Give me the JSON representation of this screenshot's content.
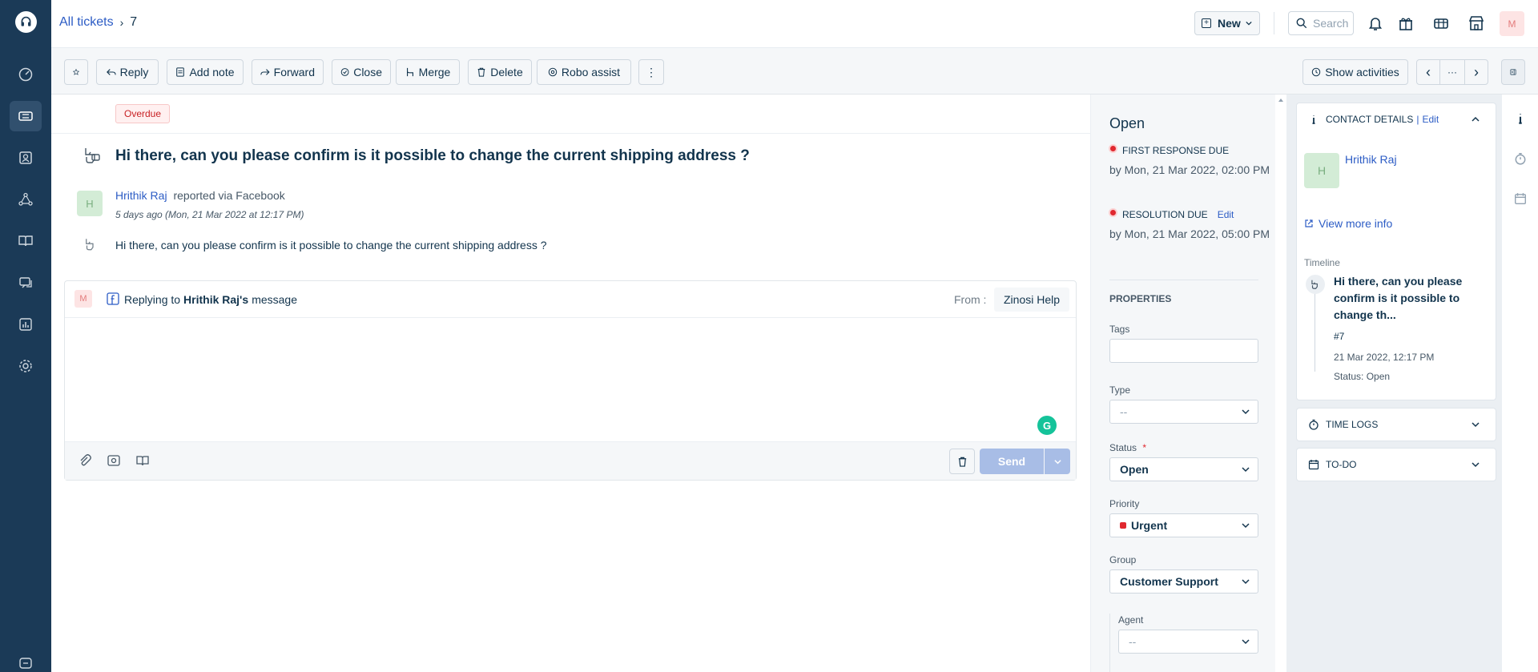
{
  "breadcrumb": {
    "link": "All tickets",
    "separator": "›",
    "ticket_number": "7"
  },
  "topbar": {
    "new_label": "New",
    "search_placeholder": "Search",
    "user_initial": "M"
  },
  "toolbar": {
    "reply": "Reply",
    "add_note": "Add note",
    "forward": "Forward",
    "close": "Close",
    "merge": "Merge",
    "delete": "Delete",
    "robo_assist": "Robo assist",
    "more": "⋮",
    "show_activities": "Show activities",
    "prev": "‹",
    "dots": "···",
    "next": "›"
  },
  "ticket": {
    "badge": "Overdue",
    "subject": "Hi there, can you please confirm is it possible to change the current shipping address ?",
    "requester_initial": "H",
    "requester_name": "Hrithik Raj",
    "reported_via": "reported via Facebook",
    "time": "5 days ago (Mon, 21 Mar 2022 at 12:17 PM)",
    "message": "Hi there, can you please confirm is it possible to change the current shipping address ?"
  },
  "reply": {
    "agent_initial": "M",
    "replying_prefix": "Replying to",
    "replying_name": "Hrithik Raj's",
    "replying_suffix": "message",
    "from_label": "From :",
    "from_value": "Zinosi Help",
    "grammarly": "G",
    "send": "Send"
  },
  "properties": {
    "status_title": "Open",
    "first_response_label": "FIRST RESPONSE DUE",
    "first_response_value": "by Mon, 21 Mar 2022, 02:00 PM",
    "resolution_label": "RESOLUTION DUE",
    "resolution_edit": "Edit",
    "resolution_value": "by Mon, 21 Mar 2022, 05:00 PM",
    "heading": "PROPERTIES",
    "tags_label": "Tags",
    "type_label": "Type",
    "type_value": "--",
    "status_label": "Status",
    "status_required": "*",
    "status_value": "Open",
    "priority_label": "Priority",
    "priority_value": "Urgent",
    "group_label": "Group",
    "group_value": "Customer Support",
    "agent_label": "Agent",
    "agent_value": "--"
  },
  "contact": {
    "header": "CONTACT DETAILS",
    "header_sep": "|",
    "edit": "Edit",
    "initial": "H",
    "name": "Hrithik Raj",
    "view_more": "View more info",
    "timeline_label": "Timeline",
    "timeline_title": "Hi there, can you please confirm is it possible to change th...",
    "timeline_number": "#7",
    "timeline_date": "21 Mar 2022, 12:17 PM",
    "timeline_status": "Status: Open"
  },
  "panels": {
    "time_logs": "TIME LOGS",
    "todo": "TO-DO"
  },
  "colors": {
    "nav_bg": "#1b3a57",
    "link": "#2c5cc5",
    "overdue": "#c82124",
    "send_disabled": "#a8bde6"
  }
}
